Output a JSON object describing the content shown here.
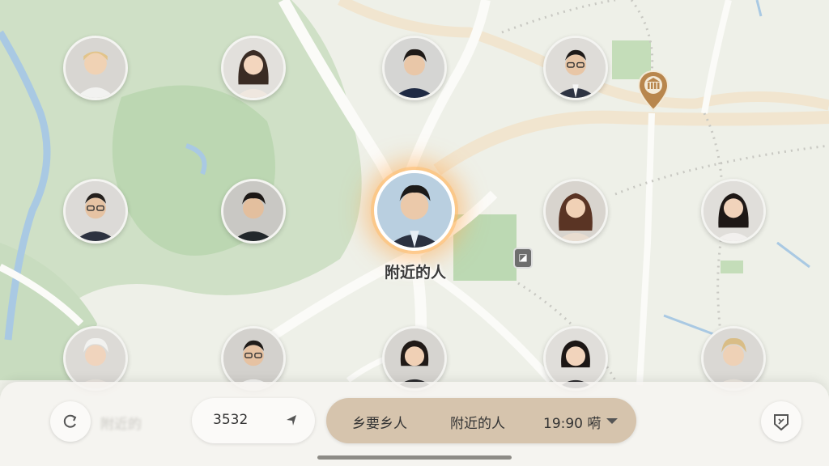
{
  "map": {
    "center_label": "附近的人",
    "poi_icon": "building-pin-icon",
    "marker_icon": "chat-marker-icon"
  },
  "avatars": [
    {
      "name": "avatar-blond-young-man"
    },
    {
      "name": "avatar-woman-long-hair"
    },
    {
      "name": "avatar-young-man-navy-jacket"
    },
    {
      "name": "avatar-man-glasses-suit"
    },
    {
      "name": "avatar-man-glasses-blazer"
    },
    {
      "name": "avatar-young-man-dark-jacket"
    },
    {
      "name": "avatar-center-man-suit"
    },
    {
      "name": "avatar-woman-wavy-hair"
    },
    {
      "name": "avatar-woman-dark-hair"
    },
    {
      "name": "avatar-white-haired-person"
    },
    {
      "name": "avatar-man-glasses-shirt"
    },
    {
      "name": "avatar-woman-short-hair"
    },
    {
      "name": "avatar-woman-bob-hair"
    },
    {
      "name": "avatar-blond-person"
    }
  ],
  "bottom_bar": {
    "left_button_icon": "refresh-icon",
    "faded_text": "附近的",
    "count": "3532",
    "count_arrow_icon": "location-arrow-icon",
    "filters": [
      "乡要乡人",
      "附近的人",
      "19:90 嗬"
    ],
    "right_button_icon": "map-shield-icon"
  },
  "colors": {
    "accent_glow": "#ffa84f",
    "filter_bar": "#d6c4ad",
    "pin": "#b8864d"
  }
}
